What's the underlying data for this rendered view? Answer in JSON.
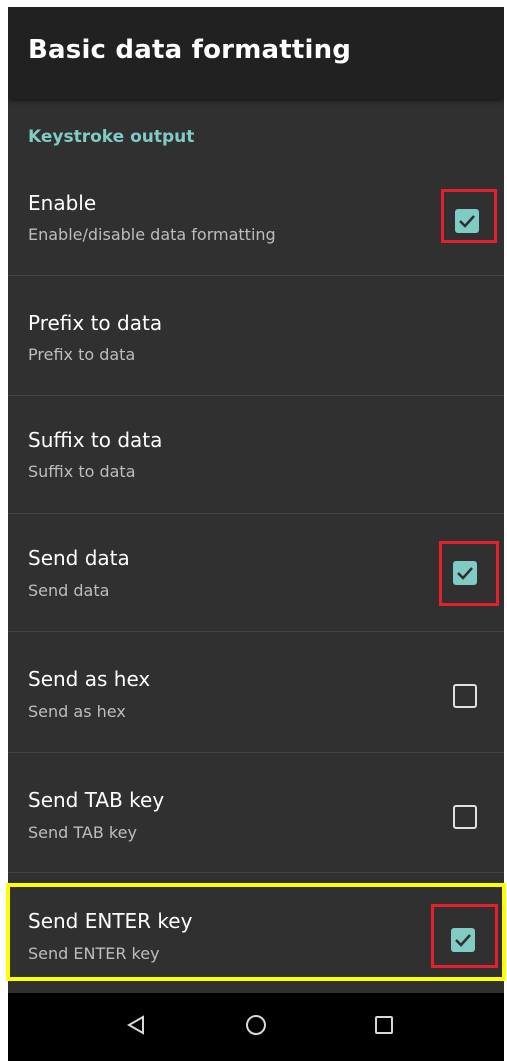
{
  "appbar": {
    "title": "Basic data formatting"
  },
  "section": {
    "header": "Keystroke output"
  },
  "preferences": [
    {
      "title": "Enable",
      "summary": "Enable/disable data formatting",
      "checkbox": "checked"
    },
    {
      "title": "Prefix to data",
      "summary": "Prefix to data",
      "checkbox": "none"
    },
    {
      "title": "Suffix to data",
      "summary": "Suffix to data",
      "checkbox": "none"
    },
    {
      "title": "Send data",
      "summary": "Send data",
      "checkbox": "checked"
    },
    {
      "title": "Send as hex",
      "summary": "Send as hex",
      "checkbox": "unchecked"
    },
    {
      "title": "Send TAB key",
      "summary": "Send TAB key",
      "checkbox": "unchecked"
    },
    {
      "title": "Send ENTER key",
      "summary": "Send ENTER key",
      "checkbox": "checked"
    }
  ],
  "navbar": {
    "icons": [
      "back-icon",
      "home-icon",
      "recents-icon"
    ]
  },
  "colors": {
    "accent": "#80cbc4",
    "background": "#303030",
    "appbar": "#212121",
    "highlight_red": "#e5202e",
    "highlight_yellow": "#ffff00"
  }
}
